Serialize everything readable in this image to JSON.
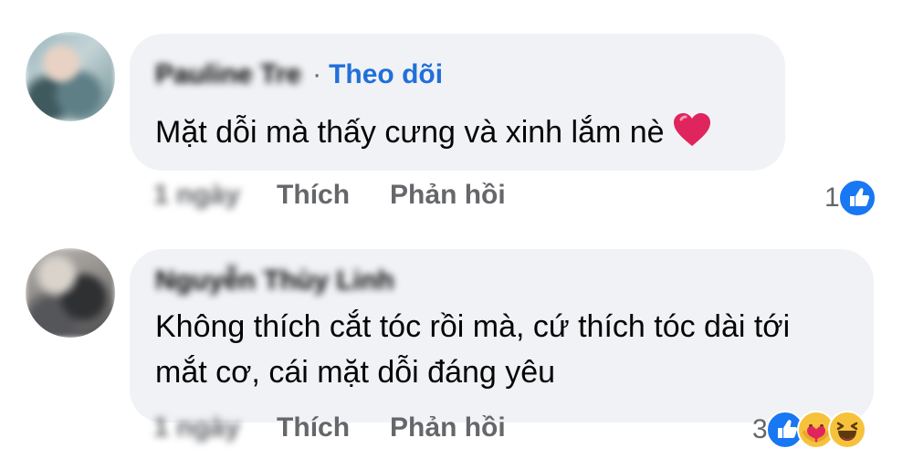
{
  "comments": [
    {
      "author": "Pauline Tre",
      "follow_label": "Theo dõi",
      "separator": "·",
      "text": "Mặt dỗi mà thấy cưng và xinh lắm nè",
      "time": "1 ngày",
      "like_label": "Thích",
      "reply_label": "Phản hồi",
      "reaction_count": "1",
      "reaction_icons": [
        "like-icon"
      ],
      "emoji_icon": "red-heart-icon"
    },
    {
      "author": "Nguyễn Thùy Linh",
      "text_lines": [
        "Không thích cắt tóc rồi mà, cứ thích tóc dài tới",
        "mắt cơ, cái mặt dỗi đáng yêu"
      ],
      "time": "1 ngày",
      "like_label": "Thích",
      "reply_label": "Phản hồi",
      "reaction_count": "3",
      "reaction_icons": [
        "like-icon",
        "care-icon",
        "haha-icon"
      ]
    }
  ],
  "colors": {
    "bubble": "#f0f2f5",
    "link_blue": "#216fdb",
    "meta_grey": "#65676b",
    "text": "#050505",
    "like_blue": "#1877f2",
    "heart_red": "#e0245e"
  }
}
